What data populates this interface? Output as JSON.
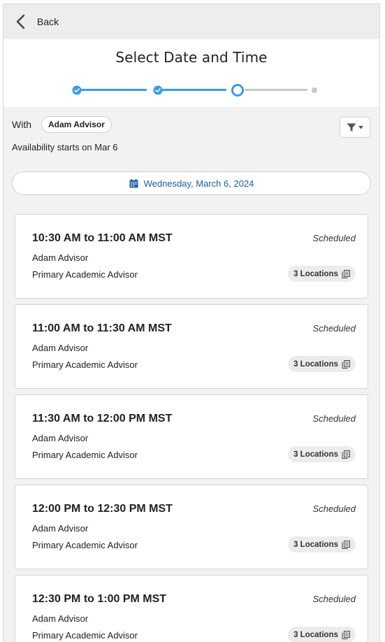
{
  "topbar": {
    "back_label": "Back"
  },
  "header": {
    "title": "Select Date and Time"
  },
  "stepper": {
    "steps": [
      "complete",
      "complete",
      "current",
      "upcoming"
    ]
  },
  "filters": {
    "with_label": "With",
    "advisor_chip": "Adam Advisor",
    "availability_text": "Availability starts on Mar 6"
  },
  "date_selector": {
    "label": "Wednesday, March 6, 2024"
  },
  "slots": [
    {
      "time": "10:30 AM to 11:00 AM MST",
      "status": "Scheduled",
      "advisor": "Adam Advisor",
      "role": "Primary Academic Advisor",
      "locations": "3 Locations"
    },
    {
      "time": "11:00 AM to 11:30 AM MST",
      "status": "Scheduled",
      "advisor": "Adam Advisor",
      "role": "Primary Academic Advisor",
      "locations": "3 Locations"
    },
    {
      "time": "11:30 AM to 12:00 PM MST",
      "status": "Scheduled",
      "advisor": "Adam Advisor",
      "role": "Primary Academic Advisor",
      "locations": "3 Locations"
    },
    {
      "time": "12:00 PM to 12:30 PM MST",
      "status": "Scheduled",
      "advisor": "Adam Advisor",
      "role": "Primary Academic Advisor",
      "locations": "3 Locations"
    },
    {
      "time": "12:30 PM to 1:00 PM MST",
      "status": "Scheduled",
      "advisor": "Adam Advisor",
      "role": "Primary Academic Advisor",
      "locations": "3 Locations"
    }
  ],
  "colors": {
    "accent": "#3a9be6",
    "link": "#1d5fa0",
    "inactive": "#c8c8c8"
  },
  "icons": {
    "back": "chevron-left-icon",
    "filter": "filter-icon",
    "calendar": "calendar-icon",
    "locations": "copy-icon"
  }
}
